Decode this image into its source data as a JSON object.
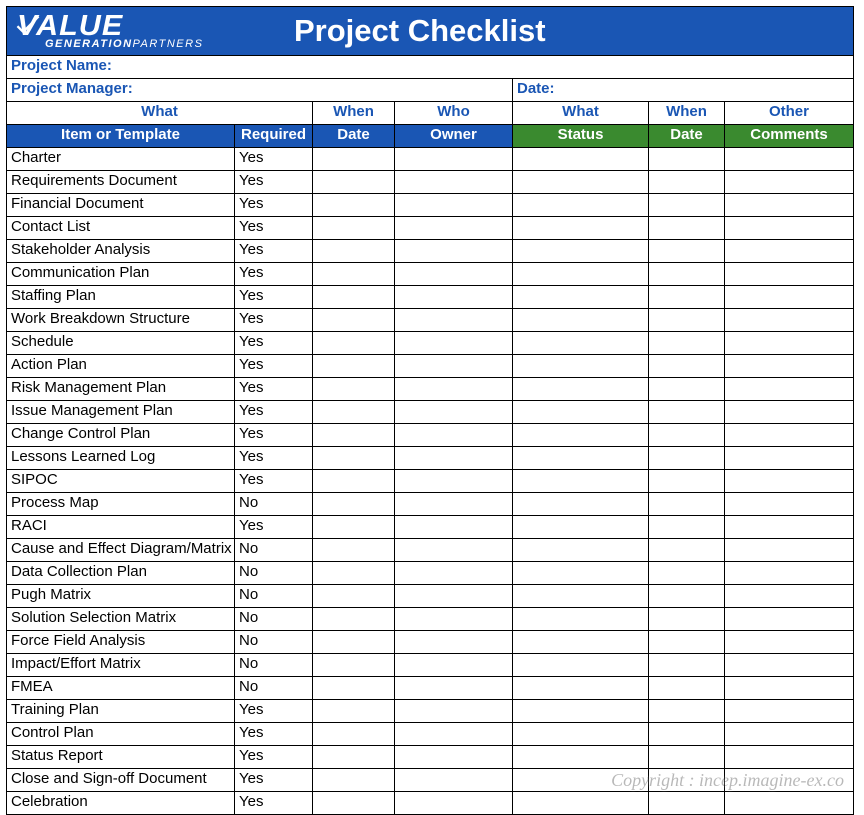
{
  "banner": {
    "logo_top": "VALUE",
    "logo_generation": "GENERATION",
    "logo_partners": "PARTNERS",
    "title": "Project Checklist"
  },
  "info": {
    "project_name_label": "Project Name:",
    "project_manager_label": "Project Manager:",
    "date_label": "Date:"
  },
  "groups": {
    "g1": "What",
    "g2": "When",
    "g3": "Who",
    "g4": "What",
    "g5": "When",
    "g6": "Other"
  },
  "headers": {
    "item": "Item or Template",
    "required": "Required",
    "date1": "Date",
    "owner": "Owner",
    "status": "Status",
    "date2": "Date",
    "comments": "Comments"
  },
  "rows": [
    {
      "item": "Charter",
      "required": "Yes"
    },
    {
      "item": "Requirements Document",
      "required": "Yes"
    },
    {
      "item": "Financial Document",
      "required": "Yes"
    },
    {
      "item": "Contact List",
      "required": "Yes"
    },
    {
      "item": "Stakeholder Analysis",
      "required": "Yes"
    },
    {
      "item": "Communication Plan",
      "required": "Yes"
    },
    {
      "item": "Staffing Plan",
      "required": "Yes"
    },
    {
      "item": "Work Breakdown Structure",
      "required": "Yes"
    },
    {
      "item": "Schedule",
      "required": "Yes"
    },
    {
      "item": "Action Plan",
      "required": "Yes"
    },
    {
      "item": "Risk Management Plan",
      "required": "Yes"
    },
    {
      "item": "Issue Management Plan",
      "required": "Yes"
    },
    {
      "item": "Change Control Plan",
      "required": "Yes"
    },
    {
      "item": "Lessons Learned Log",
      "required": "Yes"
    },
    {
      "item": "SIPOC",
      "required": "Yes"
    },
    {
      "item": "Process Map",
      "required": "No"
    },
    {
      "item": "RACI",
      "required": "Yes"
    },
    {
      "item": "Cause and Effect Diagram/Matrix",
      "required": "No"
    },
    {
      "item": "Data Collection Plan",
      "required": "No"
    },
    {
      "item": "Pugh Matrix",
      "required": "No"
    },
    {
      "item": "Solution Selection Matrix",
      "required": "No"
    },
    {
      "item": "Force Field Analysis",
      "required": "No"
    },
    {
      "item": "Impact/Effort Matrix",
      "required": "No"
    },
    {
      "item": "FMEA",
      "required": "No"
    },
    {
      "item": "Training Plan",
      "required": "Yes"
    },
    {
      "item": "Control Plan",
      "required": "Yes"
    },
    {
      "item": "Status Report",
      "required": "Yes"
    },
    {
      "item": "Close and Sign-off Document",
      "required": "Yes"
    },
    {
      "item": "Celebration",
      "required": "Yes"
    }
  ],
  "copyright": "Copyright : incep.imagine-ex.co"
}
